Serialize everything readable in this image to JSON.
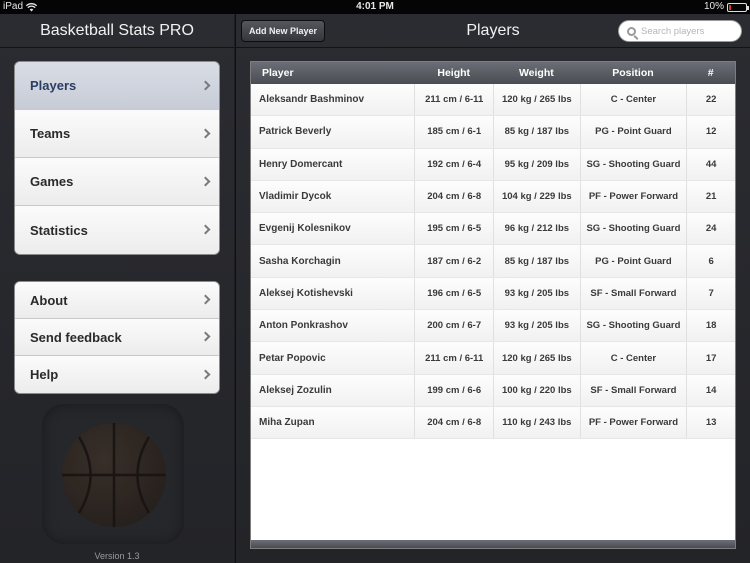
{
  "status": {
    "carrier": "iPad",
    "time": "4:01 PM",
    "battery": "10%",
    "battery_level": 0.1
  },
  "left": {
    "title": "Basketball Stats PRO",
    "main_menu": [
      {
        "label": "Players",
        "selected": true
      },
      {
        "label": "Teams"
      },
      {
        "label": "Games"
      },
      {
        "label": "Statistics"
      }
    ],
    "secondary_menu": [
      {
        "label": "About"
      },
      {
        "label": "Send feedback"
      },
      {
        "label": "Help"
      }
    ],
    "version": "Version 1.3"
  },
  "right": {
    "add_button": "Add New Player",
    "title": "Players",
    "search_placeholder": "Search players",
    "columns": [
      "Player",
      "Height",
      "Weight",
      "Position",
      "#"
    ],
    "rows": [
      [
        "Aleksandr Bashminov",
        "211 cm / 6-11",
        "120 kg / 265 lbs",
        "C - Center",
        "22"
      ],
      [
        "Patrick Beverly",
        "185 cm / 6-1",
        "85 kg / 187 lbs",
        "PG - Point Guard",
        "12"
      ],
      [
        "Henry Domercant",
        "192 cm / 6-4",
        "95 kg / 209 lbs",
        "SG - Shooting Guard",
        "44"
      ],
      [
        "Vladimir Dycok",
        "204 cm / 6-8",
        "104 kg / 229 lbs",
        "PF - Power Forward",
        "21"
      ],
      [
        "Evgenij Kolesnikov",
        "195 cm / 6-5",
        "96 kg / 212 lbs",
        "SG - Shooting Guard",
        "24"
      ],
      [
        "Sasha Korchagin",
        "187 cm / 6-2",
        "85 kg / 187 lbs",
        "PG - Point Guard",
        "6"
      ],
      [
        "Aleksej Kotishevski",
        "196 cm / 6-5",
        "93 kg / 205 lbs",
        "SF - Small Forward",
        "7"
      ],
      [
        "Anton Ponkrashov",
        "200 cm / 6-7",
        "93 kg / 205 lbs",
        "SG - Shooting Guard",
        "18"
      ],
      [
        "Petar Popovic",
        "211 cm / 6-11",
        "120 kg / 265 lbs",
        "C - Center",
        "17"
      ],
      [
        "Aleksej Zozulin",
        "199 cm / 6-6",
        "100 kg / 220 lbs",
        "SF - Small Forward",
        "14"
      ],
      [
        "Miha Zupan",
        "204 cm / 6-8",
        "110 kg / 243 lbs",
        "PF - Power Forward",
        "13"
      ]
    ]
  }
}
